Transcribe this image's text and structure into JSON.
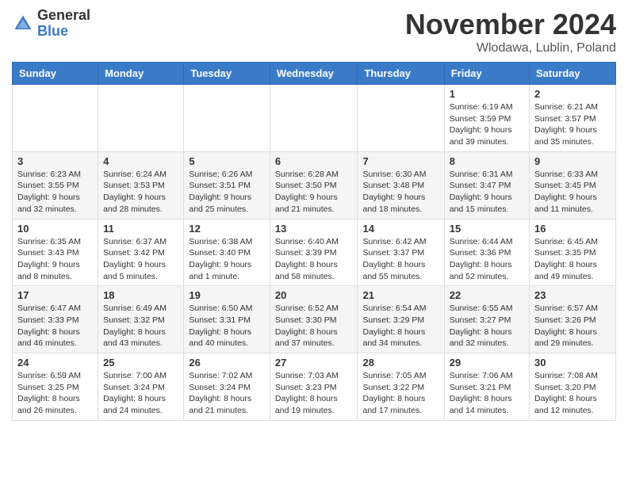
{
  "header": {
    "logo": {
      "general": "General",
      "blue": "Blue"
    },
    "title": "November 2024",
    "location": "Wlodawa, Lublin, Poland"
  },
  "weekdays": [
    "Sunday",
    "Monday",
    "Tuesday",
    "Wednesday",
    "Thursday",
    "Friday",
    "Saturday"
  ],
  "weeks": [
    [
      {
        "day": "",
        "info": ""
      },
      {
        "day": "",
        "info": ""
      },
      {
        "day": "",
        "info": ""
      },
      {
        "day": "",
        "info": ""
      },
      {
        "day": "",
        "info": ""
      },
      {
        "day": "1",
        "info": "Sunrise: 6:19 AM\nSunset: 3:59 PM\nDaylight: 9 hours\nand 39 minutes."
      },
      {
        "day": "2",
        "info": "Sunrise: 6:21 AM\nSunset: 3:57 PM\nDaylight: 9 hours\nand 35 minutes."
      }
    ],
    [
      {
        "day": "3",
        "info": "Sunrise: 6:23 AM\nSunset: 3:55 PM\nDaylight: 9 hours\nand 32 minutes."
      },
      {
        "day": "4",
        "info": "Sunrise: 6:24 AM\nSunset: 3:53 PM\nDaylight: 9 hours\nand 28 minutes."
      },
      {
        "day": "5",
        "info": "Sunrise: 6:26 AM\nSunset: 3:51 PM\nDaylight: 9 hours\nand 25 minutes."
      },
      {
        "day": "6",
        "info": "Sunrise: 6:28 AM\nSunset: 3:50 PM\nDaylight: 9 hours\nand 21 minutes."
      },
      {
        "day": "7",
        "info": "Sunrise: 6:30 AM\nSunset: 3:48 PM\nDaylight: 9 hours\nand 18 minutes."
      },
      {
        "day": "8",
        "info": "Sunrise: 6:31 AM\nSunset: 3:47 PM\nDaylight: 9 hours\nand 15 minutes."
      },
      {
        "day": "9",
        "info": "Sunrise: 6:33 AM\nSunset: 3:45 PM\nDaylight: 9 hours\nand 11 minutes."
      }
    ],
    [
      {
        "day": "10",
        "info": "Sunrise: 6:35 AM\nSunset: 3:43 PM\nDaylight: 9 hours\nand 8 minutes."
      },
      {
        "day": "11",
        "info": "Sunrise: 6:37 AM\nSunset: 3:42 PM\nDaylight: 9 hours\nand 5 minutes."
      },
      {
        "day": "12",
        "info": "Sunrise: 6:38 AM\nSunset: 3:40 PM\nDaylight: 9 hours\nand 1 minute."
      },
      {
        "day": "13",
        "info": "Sunrise: 6:40 AM\nSunset: 3:39 PM\nDaylight: 8 hours\nand 58 minutes."
      },
      {
        "day": "14",
        "info": "Sunrise: 6:42 AM\nSunset: 3:37 PM\nDaylight: 8 hours\nand 55 minutes."
      },
      {
        "day": "15",
        "info": "Sunrise: 6:44 AM\nSunset: 3:36 PM\nDaylight: 8 hours\nand 52 minutes."
      },
      {
        "day": "16",
        "info": "Sunrise: 6:45 AM\nSunset: 3:35 PM\nDaylight: 8 hours\nand 49 minutes."
      }
    ],
    [
      {
        "day": "17",
        "info": "Sunrise: 6:47 AM\nSunset: 3:33 PM\nDaylight: 8 hours\nand 46 minutes."
      },
      {
        "day": "18",
        "info": "Sunrise: 6:49 AM\nSunset: 3:32 PM\nDaylight: 8 hours\nand 43 minutes."
      },
      {
        "day": "19",
        "info": "Sunrise: 6:50 AM\nSunset: 3:31 PM\nDaylight: 8 hours\nand 40 minutes."
      },
      {
        "day": "20",
        "info": "Sunrise: 6:52 AM\nSunset: 3:30 PM\nDaylight: 8 hours\nand 37 minutes."
      },
      {
        "day": "21",
        "info": "Sunrise: 6:54 AM\nSunset: 3:29 PM\nDaylight: 8 hours\nand 34 minutes."
      },
      {
        "day": "22",
        "info": "Sunrise: 6:55 AM\nSunset: 3:27 PM\nDaylight: 8 hours\nand 32 minutes."
      },
      {
        "day": "23",
        "info": "Sunrise: 6:57 AM\nSunset: 3:26 PM\nDaylight: 8 hours\nand 29 minutes."
      }
    ],
    [
      {
        "day": "24",
        "info": "Sunrise: 6:59 AM\nSunset: 3:25 PM\nDaylight: 8 hours\nand 26 minutes."
      },
      {
        "day": "25",
        "info": "Sunrise: 7:00 AM\nSunset: 3:24 PM\nDaylight: 8 hours\nand 24 minutes."
      },
      {
        "day": "26",
        "info": "Sunrise: 7:02 AM\nSunset: 3:24 PM\nDaylight: 8 hours\nand 21 minutes."
      },
      {
        "day": "27",
        "info": "Sunrise: 7:03 AM\nSunset: 3:23 PM\nDaylight: 8 hours\nand 19 minutes."
      },
      {
        "day": "28",
        "info": "Sunrise: 7:05 AM\nSunset: 3:22 PM\nDaylight: 8 hours\nand 17 minutes."
      },
      {
        "day": "29",
        "info": "Sunrise: 7:06 AM\nSunset: 3:21 PM\nDaylight: 8 hours\nand 14 minutes."
      },
      {
        "day": "30",
        "info": "Sunrise: 7:08 AM\nSunset: 3:20 PM\nDaylight: 8 hours\nand 12 minutes."
      }
    ]
  ]
}
